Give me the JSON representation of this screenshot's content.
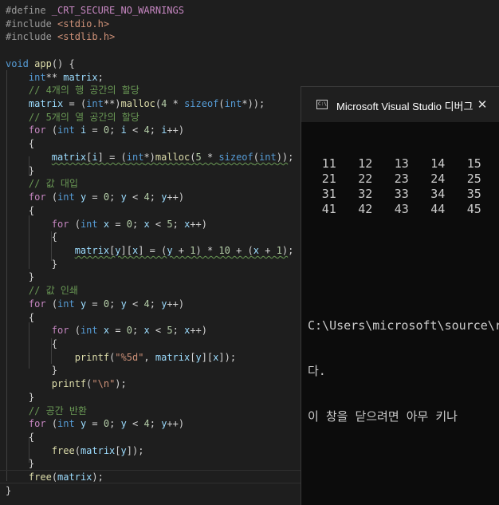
{
  "editor": {
    "lines": [
      [
        [
          "pp",
          "#define "
        ],
        [
          "mac",
          "_CRT_SECURE_NO_WARNINGS"
        ]
      ],
      [
        [
          "pp",
          "#include "
        ],
        [
          "str",
          "<stdio.h>"
        ]
      ],
      [
        [
          "pp",
          "#include "
        ],
        [
          "str",
          "<stdlib.h>"
        ]
      ],
      [],
      [
        [
          "kw",
          "void"
        ],
        [
          "op",
          " "
        ],
        [
          "fn",
          "app"
        ],
        [
          "op",
          "() {"
        ]
      ],
      [
        [
          "op",
          "    "
        ],
        [
          "kw",
          "int"
        ],
        [
          "op",
          "** "
        ],
        [
          "var",
          "matrix"
        ],
        [
          "op",
          ";"
        ]
      ],
      [
        [
          "op",
          "    "
        ],
        [
          "cmt",
          "// 4개의 행 공간의 할당"
        ]
      ],
      [
        [
          "op",
          "    "
        ],
        [
          "var",
          "matrix"
        ],
        [
          "op",
          " = ("
        ],
        [
          "kw",
          "int"
        ],
        [
          "op",
          "**)"
        ],
        [
          "fn",
          "malloc"
        ],
        [
          "op",
          "("
        ],
        [
          "num",
          "4"
        ],
        [
          "op",
          " * "
        ],
        [
          "kw",
          "sizeof"
        ],
        [
          "op",
          "("
        ],
        [
          "kw",
          "int"
        ],
        [
          "op",
          "*));"
        ]
      ],
      [
        [
          "op",
          "    "
        ],
        [
          "cmt",
          "// 5개의 열 공간의 할당"
        ]
      ],
      [
        [
          "op",
          "    "
        ],
        [
          "ctl",
          "for"
        ],
        [
          "op",
          " ("
        ],
        [
          "kw",
          "int"
        ],
        [
          "op",
          " "
        ],
        [
          "var",
          "i"
        ],
        [
          "op",
          " = "
        ],
        [
          "num",
          "0"
        ],
        [
          "op",
          "; "
        ],
        [
          "var",
          "i"
        ],
        [
          "op",
          " < "
        ],
        [
          "num",
          "4"
        ],
        [
          "op",
          "; "
        ],
        [
          "var",
          "i"
        ],
        [
          "op",
          "++)"
        ]
      ],
      [
        [
          "op",
          "    {"
        ]
      ],
      [
        [
          "op",
          "        "
        ],
        [
          "var sq",
          "matrix"
        ],
        [
          "op sq",
          "["
        ],
        [
          "var sq",
          "i"
        ],
        [
          "op sq",
          "] = ("
        ],
        [
          "kw sq",
          "int"
        ],
        [
          "op sq",
          "*)"
        ],
        [
          "fn sq",
          "malloc"
        ],
        [
          "op sq",
          "("
        ],
        [
          "num sq",
          "5"
        ],
        [
          "op sq",
          " * "
        ],
        [
          "kw sq",
          "sizeof"
        ],
        [
          "op sq",
          "("
        ],
        [
          "kw sq",
          "int"
        ],
        [
          "op sq",
          "))"
        ],
        [
          "op",
          ";"
        ]
      ],
      [
        [
          "op",
          "    }"
        ]
      ],
      [
        [
          "op",
          "    "
        ],
        [
          "cmt",
          "// 값 대입"
        ]
      ],
      [
        [
          "op",
          "    "
        ],
        [
          "ctl",
          "for"
        ],
        [
          "op",
          " ("
        ],
        [
          "kw",
          "int"
        ],
        [
          "op",
          " "
        ],
        [
          "var",
          "y"
        ],
        [
          "op",
          " = "
        ],
        [
          "num",
          "0"
        ],
        [
          "op",
          "; "
        ],
        [
          "var",
          "y"
        ],
        [
          "op",
          " < "
        ],
        [
          "num",
          "4"
        ],
        [
          "op",
          "; "
        ],
        [
          "var",
          "y"
        ],
        [
          "op",
          "++)"
        ]
      ],
      [
        [
          "op",
          "    {"
        ]
      ],
      [
        [
          "op",
          "        "
        ],
        [
          "ctl",
          "for"
        ],
        [
          "op",
          " ("
        ],
        [
          "kw",
          "int"
        ],
        [
          "op",
          " "
        ],
        [
          "var",
          "x"
        ],
        [
          "op",
          " = "
        ],
        [
          "num",
          "0"
        ],
        [
          "op",
          "; "
        ],
        [
          "var",
          "x"
        ],
        [
          "op",
          " < "
        ],
        [
          "num",
          "5"
        ],
        [
          "op",
          "; "
        ],
        [
          "var",
          "x"
        ],
        [
          "op",
          "++)"
        ]
      ],
      [
        [
          "op",
          "        {"
        ]
      ],
      [
        [
          "op",
          "            "
        ],
        [
          "var sq",
          "matrix"
        ],
        [
          "op sq",
          "["
        ],
        [
          "var sq",
          "y"
        ],
        [
          "op sq",
          "]["
        ],
        [
          "var sq",
          "x"
        ],
        [
          "op sq",
          "] = ("
        ],
        [
          "var sq",
          "y"
        ],
        [
          "op sq",
          " + "
        ],
        [
          "num sq",
          "1"
        ],
        [
          "op sq",
          ") * "
        ],
        [
          "num sq",
          "10"
        ],
        [
          "op sq",
          " + ("
        ],
        [
          "var sq",
          "x"
        ],
        [
          "op sq",
          " + "
        ],
        [
          "num sq",
          "1"
        ],
        [
          "op sq",
          ")"
        ],
        [
          "op",
          ";"
        ]
      ],
      [
        [
          "op",
          "        }"
        ]
      ],
      [
        [
          "op",
          "    }"
        ]
      ],
      [
        [
          "op",
          "    "
        ],
        [
          "cmt",
          "// 값 인쇄"
        ]
      ],
      [
        [
          "op",
          "    "
        ],
        [
          "ctl",
          "for"
        ],
        [
          "op",
          " ("
        ],
        [
          "kw",
          "int"
        ],
        [
          "op",
          " "
        ],
        [
          "var",
          "y"
        ],
        [
          "op",
          " = "
        ],
        [
          "num",
          "0"
        ],
        [
          "op",
          "; "
        ],
        [
          "var",
          "y"
        ],
        [
          "op",
          " < "
        ],
        [
          "num",
          "4"
        ],
        [
          "op",
          "; "
        ],
        [
          "var",
          "y"
        ],
        [
          "op",
          "++)"
        ]
      ],
      [
        [
          "op",
          "    {"
        ]
      ],
      [
        [
          "op",
          "        "
        ],
        [
          "ctl",
          "for"
        ],
        [
          "op",
          " ("
        ],
        [
          "kw",
          "int"
        ],
        [
          "op",
          " "
        ],
        [
          "var",
          "x"
        ],
        [
          "op",
          " = "
        ],
        [
          "num",
          "0"
        ],
        [
          "op",
          "; "
        ],
        [
          "var",
          "x"
        ],
        [
          "op",
          " < "
        ],
        [
          "num",
          "5"
        ],
        [
          "op",
          "; "
        ],
        [
          "var",
          "x"
        ],
        [
          "op",
          "++)"
        ]
      ],
      [
        [
          "op",
          "        {"
        ]
      ],
      [
        [
          "op",
          "            "
        ],
        [
          "fn",
          "printf"
        ],
        [
          "op",
          "("
        ],
        [
          "str",
          "\"%5d\""
        ],
        [
          "op",
          ", "
        ],
        [
          "var",
          "matrix"
        ],
        [
          "op",
          "["
        ],
        [
          "var",
          "y"
        ],
        [
          "op",
          "]["
        ],
        [
          "var",
          "x"
        ],
        [
          "op",
          "]);"
        ]
      ],
      [
        [
          "op",
          "        }"
        ]
      ],
      [
        [
          "op",
          "        "
        ],
        [
          "fn",
          "printf"
        ],
        [
          "op",
          "("
        ],
        [
          "str",
          "\"\\n\""
        ],
        [
          "op",
          ");"
        ]
      ],
      [
        [
          "op",
          "    }"
        ]
      ],
      [
        [
          "op",
          "    "
        ],
        [
          "cmt",
          "// 공간 반환"
        ]
      ],
      [
        [
          "op",
          "    "
        ],
        [
          "ctl",
          "for"
        ],
        [
          "op",
          " ("
        ],
        [
          "kw",
          "int"
        ],
        [
          "op",
          " "
        ],
        [
          "var",
          "y"
        ],
        [
          "op",
          " = "
        ],
        [
          "num",
          "0"
        ],
        [
          "op",
          "; "
        ],
        [
          "var",
          "y"
        ],
        [
          "op",
          " < "
        ],
        [
          "num",
          "4"
        ],
        [
          "op",
          "; "
        ],
        [
          "var",
          "y"
        ],
        [
          "op",
          "++)"
        ]
      ],
      [
        [
          "op",
          "    {"
        ]
      ],
      [
        [
          "op",
          "        "
        ],
        [
          "fn",
          "free"
        ],
        [
          "op",
          "("
        ],
        [
          "var",
          "matrix"
        ],
        [
          "op",
          "["
        ],
        [
          "var",
          "y"
        ],
        [
          "op",
          "]);"
        ]
      ],
      [
        [
          "op",
          "    }"
        ]
      ],
      [
        [
          "op",
          "    "
        ],
        [
          "fn",
          "free"
        ],
        [
          "op",
          "("
        ],
        [
          "var",
          "matrix"
        ],
        [
          "op",
          ");"
        ]
      ],
      [
        [
          "op",
          "}"
        ]
      ]
    ]
  },
  "console": {
    "title": "Microsoft Visual Studio 디버그",
    "icon": "console-app-icon",
    "close_symbol": "✕",
    "output_rows": [
      [
        "11",
        "12",
        "13",
        "14",
        "15"
      ],
      [
        "21",
        "22",
        "23",
        "24",
        "25"
      ],
      [
        "31",
        "32",
        "33",
        "34",
        "35"
      ],
      [
        "41",
        "42",
        "43",
        "44",
        "45"
      ]
    ],
    "path_line": "C:\\Users\\microsoft\\source\\r",
    "line2": "다.",
    "line3": "이 창을 닫으려면 아무 키나"
  }
}
